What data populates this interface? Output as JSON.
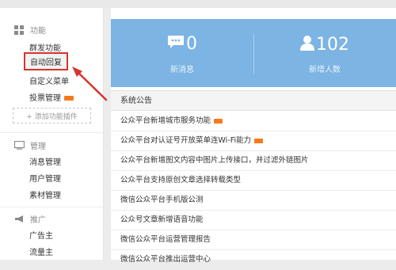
{
  "sidebar": {
    "features_title": "功能",
    "features": [
      {
        "label": "群发功能",
        "badge": false
      },
      {
        "label": "自动回复",
        "badge": false,
        "active": true
      },
      {
        "label": "自定义菜单",
        "badge": false
      },
      {
        "label": "投票管理",
        "badge": true
      }
    ],
    "add_plugin_label": "+ 添加功能插件",
    "manage_title": "管理",
    "manage": [
      "消息管理",
      "用户管理",
      "素材管理"
    ],
    "promote_title": "推广",
    "promote": [
      "广告主",
      "流量主"
    ]
  },
  "stats": [
    {
      "value": "0",
      "label": "新消息",
      "icon": "message-icon"
    },
    {
      "value": "102",
      "label": "新增人数",
      "icon": "user-icon"
    }
  ],
  "notices": {
    "header": "系统公告",
    "items": [
      {
        "text": "公众平台新增城市服务功能",
        "badge": true
      },
      {
        "text": "公众平台对认证号开放菜单连Wi-Fi能力",
        "badge": true
      },
      {
        "text": "公众平台新增图文内容中图片上传接口，并过滤外链图片",
        "badge": false
      },
      {
        "text": "公众平台支持原创文章选择转载类型",
        "badge": false
      },
      {
        "text": "微信公众平台手机版公测",
        "badge": false
      },
      {
        "text": "公众号文章新增语音功能",
        "badge": false
      },
      {
        "text": "微信公众平台运营管理报告",
        "badge": false
      },
      {
        "text": "微信公众平台推出运营中心",
        "badge": false
      }
    ]
  },
  "colors": {
    "accent_blue": "#7cb4e3",
    "highlight_red": "#d9332d",
    "new_badge": "#f37b1d"
  }
}
